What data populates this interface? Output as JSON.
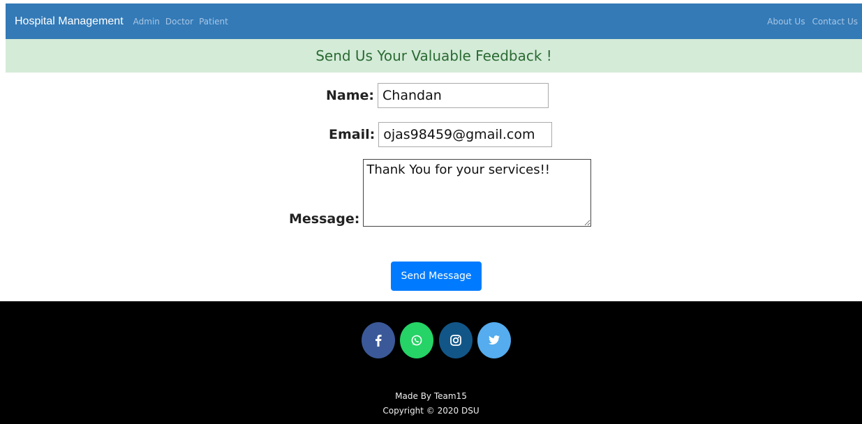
{
  "navbar": {
    "brand": "Hospital Management",
    "left_links": [
      "Admin",
      "Doctor",
      "Patient"
    ],
    "right_links": [
      "About Us",
      "Contact Us"
    ],
    "bg_color": "#337ab7"
  },
  "banner": {
    "title": "Send Us Your Valuable Feedback !",
    "bg_color": "#d4ebd8"
  },
  "form": {
    "name_label": "Name:",
    "name_value": "Chandan",
    "email_label": "Email:",
    "email_value": "ojas98459@gmail.com",
    "message_label": "Message:",
    "message_value": "Thank You for your services!!",
    "submit_label": "Send Message"
  },
  "footer": {
    "social_icons": [
      {
        "name": "facebook-icon",
        "color": "#3b5998"
      },
      {
        "name": "whatsapp-icon",
        "color": "#25d366"
      },
      {
        "name": "instagram-icon",
        "color": "#125688"
      },
      {
        "name": "twitter-icon",
        "color": "#55acee"
      }
    ],
    "made_by": "Made By Team15",
    "copyright": "Copyright © 2020 DSU"
  }
}
